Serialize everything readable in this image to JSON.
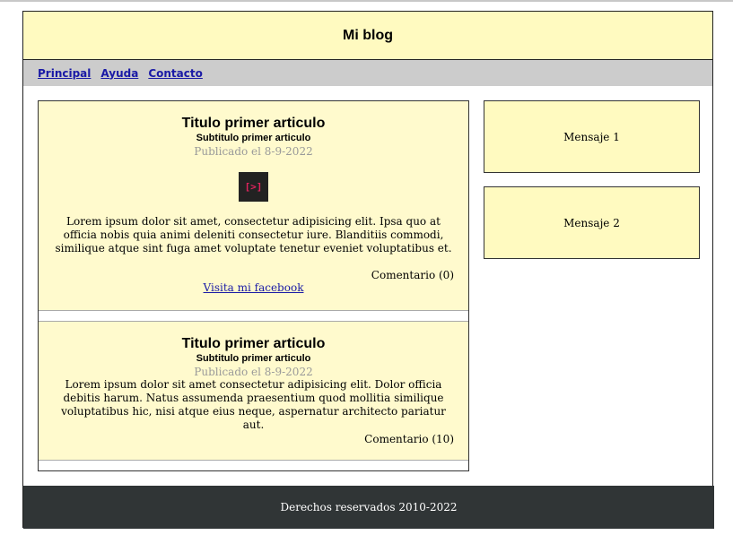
{
  "header": {
    "title": "Mi blog"
  },
  "nav": {
    "items": [
      {
        "label": "Principal"
      },
      {
        "label": "Ayuda"
      },
      {
        "label": "Contacto"
      }
    ]
  },
  "articles": [
    {
      "title": "Titulo primer articulo",
      "subtitle": "Subtitulo primer articulo",
      "date": "Publicado el 8-9-2022",
      "media_label": "[>]",
      "body": "Lorem ipsum dolor sit amet, consectetur adipisicing elit. Ipsa quo at officia nobis quia animi deleniti consectetur iure. Blanditiis commodi, similique atque sint fuga amet voluptate tenetur eveniet voluptatibus et.",
      "comments": "Comentario (0)",
      "link": "Visita mi facebook"
    },
    {
      "title": "Titulo primer articulo",
      "subtitle": "Subtitulo primer articulo",
      "date": "Publicado el 8-9-2022",
      "body": "Lorem ipsum dolor sit amet consectetur adipisicing elit. Dolor officia debitis harum. Natus assumenda praesentium quod mollitia similique voluptatibus hic, nisi atque eius neque, aspernatur architecto pariatur aut.",
      "comments": "Comentario (10)"
    }
  ],
  "aside": {
    "messages": [
      "Mensaje 1",
      "Mensaje 2"
    ]
  },
  "footer": {
    "text": "Derechos reservados 2010-2022"
  },
  "colors": {
    "header_bg": "#fffac0",
    "article_bg": "#fffacd",
    "nav_bg": "#cccccc",
    "footer_bg": "#303536",
    "link": "#1a1aa6"
  }
}
